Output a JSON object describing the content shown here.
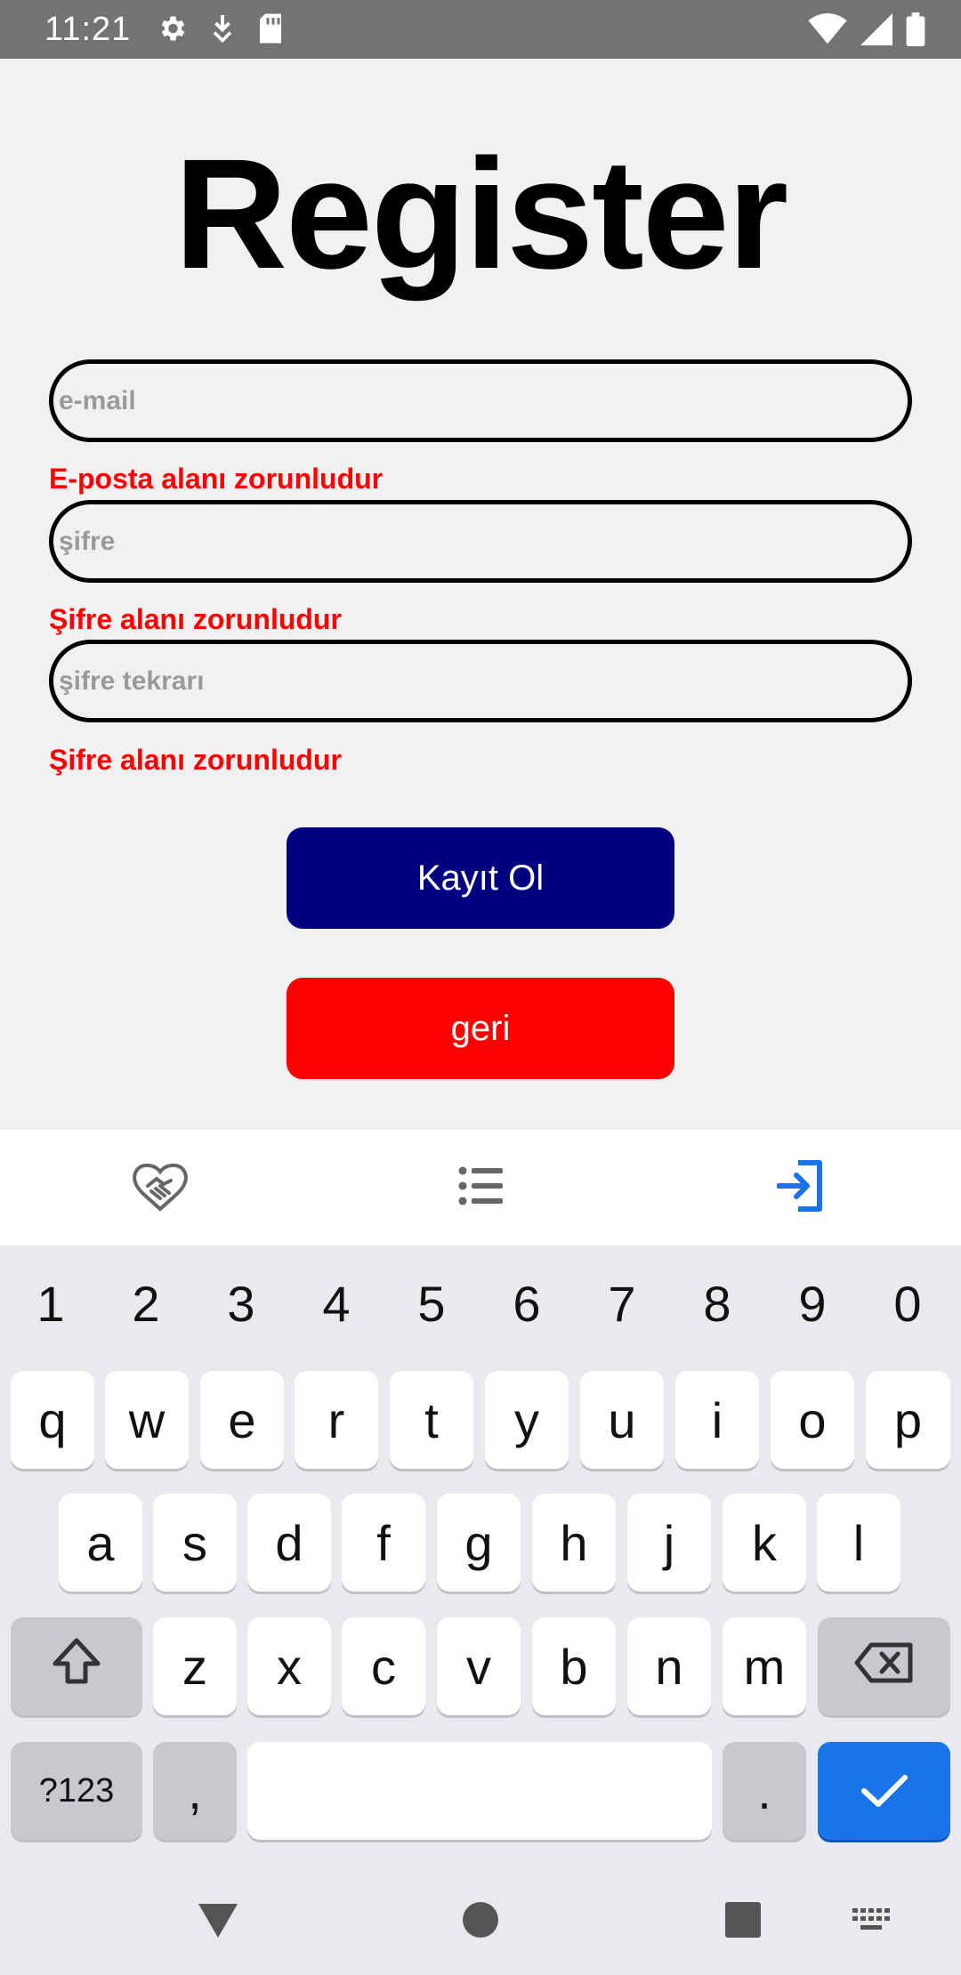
{
  "status_bar": {
    "time": "11:21",
    "left_icons": [
      "gear-icon",
      "download-icon",
      "sd-card-icon"
    ],
    "right_icons": [
      "wifi-icon",
      "signal-icon",
      "battery-icon"
    ]
  },
  "page": {
    "title": "Register"
  },
  "form": {
    "email": {
      "placeholder": "e-mail",
      "value": "",
      "error": "E-posta alanı zorunludur"
    },
    "password": {
      "placeholder": "şifre",
      "value": "",
      "error": "Şifre alanı zorunludur"
    },
    "password_repeat": {
      "placeholder": "şifre tekrarı",
      "value": "",
      "error": "Şifre alanı zorunludur"
    },
    "register_label": "Kayıt Ol",
    "back_label": "geri",
    "colors": {
      "register": "#000080",
      "back": "#ff0000",
      "error": "#ff0000"
    }
  },
  "tab_bar": {
    "tabs": [
      {
        "icon": "handshake-icon",
        "active": false
      },
      {
        "icon": "list-icon",
        "active": false
      },
      {
        "icon": "login-icon",
        "active": true
      }
    ],
    "active_color": "#1b73e8"
  },
  "keyboard": {
    "numbers": [
      "1",
      "2",
      "3",
      "4",
      "5",
      "6",
      "7",
      "8",
      "9",
      "0"
    ],
    "row1": [
      "q",
      "w",
      "e",
      "r",
      "t",
      "y",
      "u",
      "i",
      "o",
      "p"
    ],
    "row2": [
      "a",
      "s",
      "d",
      "f",
      "g",
      "h",
      "j",
      "k",
      "l"
    ],
    "row3": [
      "z",
      "x",
      "c",
      "v",
      "b",
      "n",
      "m"
    ],
    "symbols_label": "?123",
    "comma": ",",
    "period": ".",
    "enter_icon": "check-icon",
    "shift_icon": "shift-icon",
    "backspace_icon": "backspace-icon"
  },
  "nav_bar": {
    "items": [
      "back-triangle-icon",
      "home-circle-icon",
      "recents-square-icon",
      "keyboard-switch-icon"
    ]
  }
}
